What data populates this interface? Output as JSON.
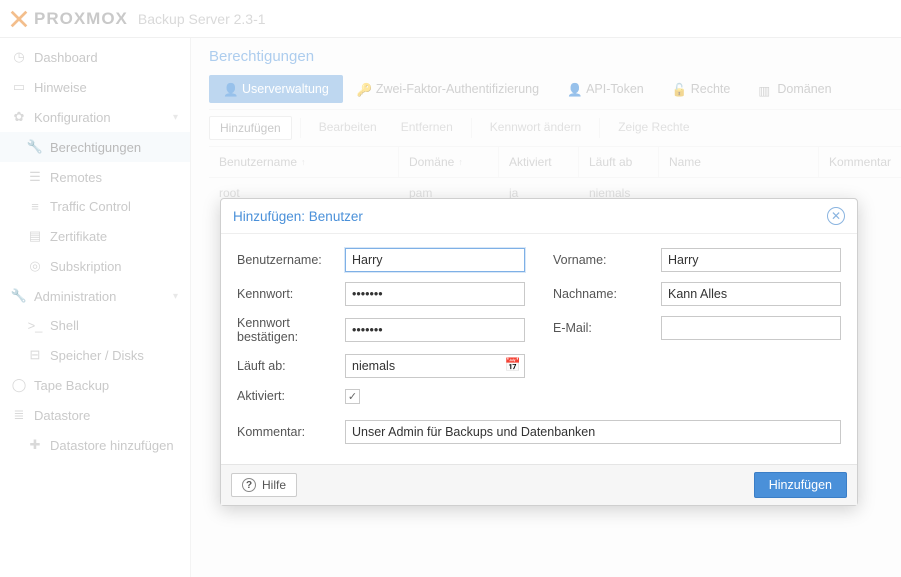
{
  "header": {
    "brand": "PROXMOX",
    "product": "Backup Server 2.3-1"
  },
  "sidebar": {
    "items": [
      {
        "label": "Dashboard",
        "icon": "gauge"
      },
      {
        "label": "Hinweise",
        "icon": "clipboard"
      },
      {
        "label": "Konfiguration",
        "icon": "gear",
        "expandable": true,
        "children": [
          {
            "label": "Berechtigungen",
            "icon": "wrench",
            "selected": true
          },
          {
            "label": "Remotes",
            "icon": "server"
          },
          {
            "label": "Traffic Control",
            "icon": "sliders"
          },
          {
            "label": "Zertifikate",
            "icon": "cert"
          },
          {
            "label": "Subskription",
            "icon": "lifebuoy"
          }
        ]
      },
      {
        "label": "Administration",
        "icon": "wrench2",
        "expandable": true,
        "children": [
          {
            "label": "Shell",
            "icon": "terminal"
          },
          {
            "label": "Speicher / Disks",
            "icon": "hdd"
          }
        ]
      },
      {
        "label": "Tape Backup",
        "icon": "tape"
      },
      {
        "label": "Datastore",
        "icon": "db",
        "children": [
          {
            "label": "Datastore hinzufügen",
            "icon": "plus"
          }
        ]
      }
    ]
  },
  "main": {
    "title": "Berechtigungen",
    "tabs": [
      {
        "label": "Userverwaltung",
        "active": true
      },
      {
        "label": "Zwei-Faktor-Authentifizierung"
      },
      {
        "label": "API-Token"
      },
      {
        "label": "Rechte"
      },
      {
        "label": "Domänen"
      }
    ],
    "toolbar": {
      "add": "Hinzufügen",
      "edit": "Bearbeiten",
      "remove": "Entfernen",
      "changepw": "Kennwort ändern",
      "showperm": "Zeige Rechte"
    },
    "columns": {
      "username": "Benutzername",
      "realm": "Domäne",
      "enabled": "Aktiviert",
      "expires": "Läuft ab",
      "name": "Name",
      "comment": "Kommentar"
    },
    "rows": [
      {
        "username": "root",
        "realm": "pam",
        "enabled": "ja",
        "expires": "niemals",
        "name": "",
        "comment": ""
      }
    ]
  },
  "modal": {
    "title": "Hinzufügen: Benutzer",
    "labels": {
      "username": "Benutzername:",
      "password": "Kennwort:",
      "confirm": "Kennwort bestätigen:",
      "expires": "Läuft ab:",
      "enabled": "Aktiviert:",
      "firstname": "Vorname:",
      "lastname": "Nachname:",
      "email": "E-Mail:",
      "comment": "Kommentar:"
    },
    "values": {
      "username": "Harry",
      "password": "•••••••",
      "confirm": "•••••••",
      "expires": "niemals",
      "enabled": true,
      "firstname": "Harry",
      "lastname": "Kann Alles",
      "email": "",
      "comment": "Unser Admin für Backups und Datenbanken"
    },
    "help": "Hilfe",
    "submit": "Hinzufügen"
  }
}
